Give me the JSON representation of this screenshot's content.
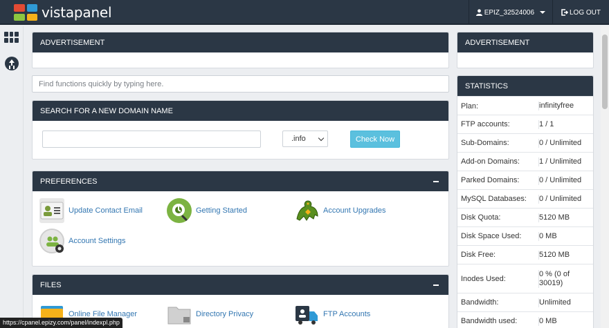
{
  "header": {
    "logo_text": "vistapanel",
    "logo_colors": [
      "#e34b34",
      "#2f9ad6",
      "#8cc63f",
      "#f6b21a"
    ],
    "username": "EPIZ_32524006",
    "logout_label": "LOG OUT"
  },
  "advertisement_label": "ADVERTISEMENT",
  "search": {
    "placeholder": "Find functions quickly by typing here."
  },
  "domain_search": {
    "title": "SEARCH FOR A NEW DOMAIN NAME",
    "tld_selected": ".info",
    "button_label": "Check Now"
  },
  "preferences": {
    "title": "PREFERENCES",
    "items": [
      {
        "label": "Update Contact Email"
      },
      {
        "label": "Getting Started"
      },
      {
        "label": "Account Upgrades"
      },
      {
        "label": "Account Settings"
      }
    ]
  },
  "files": {
    "title": "FILES",
    "items": [
      {
        "label": "Online File Manager"
      },
      {
        "label": "Directory Privacy"
      },
      {
        "label": "FTP Accounts"
      }
    ]
  },
  "statistics": {
    "title": "STATISTICS",
    "rows": [
      {
        "key": "Plan:",
        "value": "infinityfree"
      },
      {
        "key": "FTP accounts:",
        "value": "1 / 1"
      },
      {
        "key": "Sub-Domains:",
        "value": "0 / Unlimited"
      },
      {
        "key": "Add-on Domains:",
        "value": "1 / Unlimited"
      },
      {
        "key": "Parked Domains:",
        "value": "0 / Unlimited"
      },
      {
        "key": "MySQL Databases:",
        "value": "0 / Unlimited"
      },
      {
        "key": "Disk Quota:",
        "value": "5120 MB"
      },
      {
        "key": "Disk Space Used:",
        "value": "0 MB"
      },
      {
        "key": "Disk Free:",
        "value": "5120 MB"
      },
      {
        "key": "Inodes Used:",
        "value": "0 % (0 of 30019)"
      },
      {
        "key": "Bandwidth:",
        "value": "Unlimited"
      },
      {
        "key": "Bandwidth used:",
        "value": "0 MB"
      }
    ]
  },
  "status_url": "https://cpanel.epizy.com/panel/indexpl.php"
}
